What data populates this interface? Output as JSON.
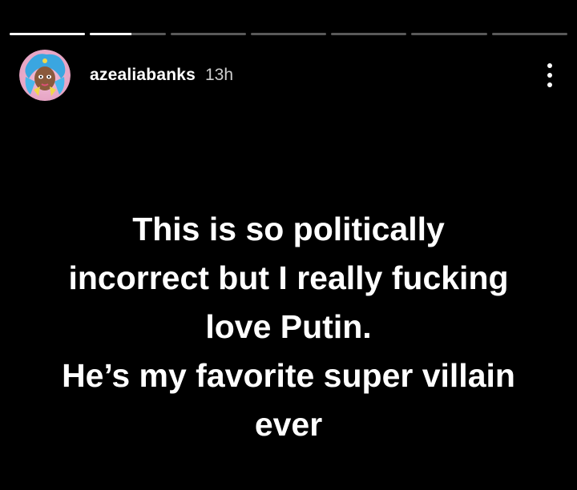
{
  "story": {
    "progress": {
      "segment_count": 7,
      "active_index": 1,
      "active_fraction": 0.55
    },
    "header": {
      "username": "azealiabanks",
      "time_ago": "13h",
      "avatar_icon": "profile-avatar",
      "menu_icon": "more-options-vertical-icon"
    },
    "text_lines": [
      "This is so politically",
      "incorrect but I really fucking",
      "love Putin.",
      "He’s my favorite super villain",
      "ever"
    ],
    "colors": {
      "background": "#000000",
      "text": "#ffffff",
      "progress_track": "rgba(255,255,255,0.35)",
      "progress_fill": "#ffffff"
    }
  }
}
